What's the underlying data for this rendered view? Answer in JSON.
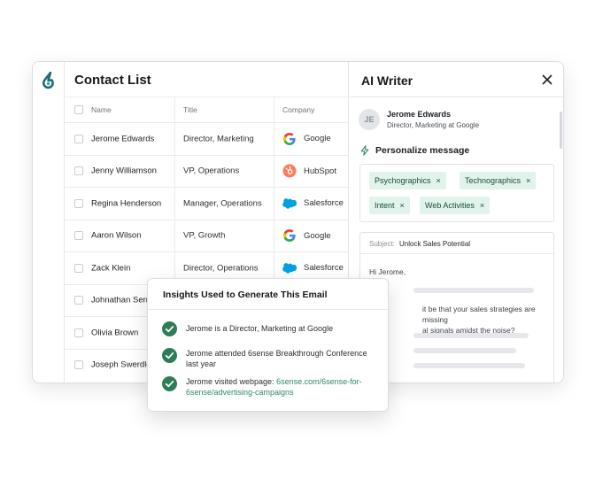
{
  "contact_list": {
    "title": "Contact List",
    "columns": {
      "name": "Name",
      "title": "Title",
      "company": "Company"
    },
    "rows": [
      {
        "name": "Jerome Edwards",
        "title": "Director, Marketing",
        "company": "Google",
        "logo": "google-icon"
      },
      {
        "name": "Jenny Williamson",
        "title": "VP, Operations",
        "company": "HubSpot",
        "logo": "hubspot-icon"
      },
      {
        "name": "Regina Henderson",
        "title": "Manager, Operations",
        "company": "Salesforce",
        "logo": "salesforce-icon"
      },
      {
        "name": "Aaron Wilson",
        "title": "VP, Growth",
        "company": "Google",
        "logo": "google-icon"
      },
      {
        "name": "Zack Klein",
        "title": "Director, Operations",
        "company": "Salesforce",
        "logo": "salesforce-icon"
      },
      {
        "name": "Johnathan Serr",
        "title": "",
        "company": "",
        "logo": ""
      },
      {
        "name": "Olivia Brown",
        "title": "",
        "company": "",
        "logo": ""
      },
      {
        "name": "Joseph Swerdlo",
        "title": "",
        "company": "",
        "logo": ""
      }
    ]
  },
  "ai_writer": {
    "title": "AI Writer",
    "avatar_initials": "JE",
    "person_name": "Jerome Edwards",
    "person_role": "Director, Marketing at Google",
    "personalize_label": "Personalize message",
    "tags": [
      "Psychographics",
      "Technographics",
      "Intent",
      "Web Activities"
    ],
    "tag_remove": "×",
    "subject_label": "Subject:",
    "subject_value": "Unlock Sales Potential",
    "greeting": "Hi Jerome,",
    "body_line1": "it be that your sales strategies are missing",
    "body_line2": "al signals amidst the noise?"
  },
  "insights": {
    "title": "Insights Used to Generate This Email",
    "item1": "Jerome is a Director, Marketing at Google",
    "item2": "Jerome attended 6sense Breakthrough Conference last year",
    "item3_prefix": "Jerome visited webpage: ",
    "item3_link": "6sense.com/6sense-for-6sense/advertising-campaigns"
  },
  "colors": {
    "accent_green": "#2e8a63",
    "tag_bg": "#e0f4ec",
    "brand_teal": "#1f6e78"
  }
}
